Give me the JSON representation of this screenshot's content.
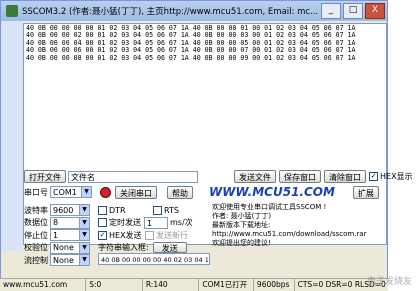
{
  "window": {
    "title": "SSCOM3.2 (作者:聂小猛(丁丁), 主页http://www.mcu51.com, Email: mc...",
    "min": "_",
    "max": "□",
    "close": "X"
  },
  "receive_lines": [
    "40 0B 00 00 00 00 01 02 03 04 05 06 07 1A 40 0B 00 00 01 00 01 02 03 04 05 06 07 1A",
    "40 0B 00 00 02 00 01 02 03 04 05 06 07 1A 40 0B 00 00 03 00 01 02 03 04 05 06 07 1A",
    "40 0B 00 00 04 00 01 02 03 04 05 06 07 1A 40 0B 00 00 05 00 01 02 03 04 05 06 07 1A",
    "40 0B 00 00 06 00 01 02 03 04 05 06 07 1A 40 0B 00 00 07 00 01 02 03 04 05 06 07 1A",
    "40 0B 00 00 08 00 01 02 03 04 05 06 07 1A 40 0B 00 00 09 00 01 02 03 04 05 06 07 1A"
  ],
  "file_row": {
    "open_file": "打开文件",
    "file_name": "文件名",
    "send_file": "发送文件",
    "save_window": "保存窗口",
    "clear_window": "清除窗口",
    "hex_display": "HEX显示"
  },
  "port_row": {
    "port_label": "串口号",
    "port_value": "COM1",
    "close_port": "关闭串口",
    "help": "帮助",
    "logo": "WWW.MCU51.COM",
    "expand": "扩展"
  },
  "settings": {
    "baud_label": "波特率",
    "baud_value": "9600",
    "data_label": "数据位",
    "data_value": "8",
    "stop_label": "停止位",
    "stop_value": "1",
    "parity_label": "校验位",
    "parity_value": "None",
    "flow_label": "流控制",
    "flow_value": "None"
  },
  "options": {
    "dtr": "DTR",
    "rts": "RTS",
    "timed_send": "定时发送",
    "interval": "1",
    "interval_unit": "ms/次",
    "hex_send": "HEX发送",
    "send_newline": "发送新行",
    "input_label": "字符串输入框:",
    "send": "发送",
    "send_data": "40 0B 00 00 00 00 40 02 03 04 1A 06 07 1A"
  },
  "info_lines": [
    "欢迎使用专业串口调试工具SSCOM !",
    "作者: 聂小猛(丁丁)",
    "最新版本下载地址:",
    "http://www.mcu51.com/download/sscom.rar",
    "欢迎提出您的建议!"
  ],
  "status": {
    "site": "www.mcu51.com",
    "s": "S:0",
    "r": "R:140",
    "port_state": "COM1已打开",
    "baud": "9600bps",
    "signals": "CTS=0 DSR=0 RLSD=0"
  },
  "watermark": "电子发烧友"
}
